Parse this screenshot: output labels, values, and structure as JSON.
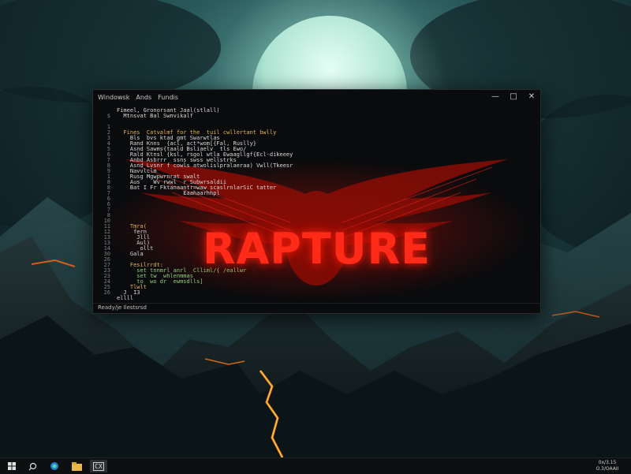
{
  "terminal": {
    "menu": [
      "Windowsk",
      "Ands",
      "Fundis"
    ],
    "status": "Ready/je Ilestsrsd",
    "logo_text": "RAPTURE",
    "lines": [
      {
        "num": "",
        "text": "Fimeel, Gronorsant Jaal(stlall)",
        "color": "#d8d8d8"
      },
      {
        "num": "$",
        "text": "  Mtnsvat Bal Swnvikalf",
        "color": "#d8d8d8"
      },
      {
        "num": "",
        "text": "",
        "color": "#d8d8d8"
      },
      {
        "num": "1",
        "text": "",
        "color": "#d8d8d8"
      },
      {
        "num": "2",
        "text": "  Fines  Catvalmf for the  tuil cwllertant bwlly",
        "color": "#e8b44c"
      },
      {
        "num": "3",
        "text": "    Bls  bvs ktad gmt Swarwtlas",
        "color": "#d8d8d8"
      },
      {
        "num": "4",
        "text": "    Rand Knns  {acl, act*wom[{Fal, Ruslly}",
        "color": "#d8d8d8"
      },
      {
        "num": "5",
        "text": "    Asnd Sawms{taald Bsliaelv  tls Ewo/",
        "color": "#d8d8d8"
      },
      {
        "num": "6",
        "text": "    Rald Ktnsl {ksl, rsgol wtla Ewaagllgf{Ecl-dikeeey",
        "color": "#d8d8d8"
      },
      {
        "num": "7",
        "text": "    Anbd Asbrrr  ssns swss wellstrks",
        "color": "#d8d8d8"
      },
      {
        "num": "8",
        "text": "    Asnd Lvsnr f cowls atwolislpralaeraa) Vwll(Tkeesr",
        "color": "#d8d8d8"
      },
      {
        "num": "9",
        "text": "    Navvlclm",
        "color": "#d8d8d8"
      },
      {
        "num": "1",
        "text": "    Rusg Mgwpwrnrat swalt",
        "color": "#d8d8d8"
      },
      {
        "num": "8",
        "text": "    Aus    Wv rwwl  r Subwrsaldii",
        "color": "#d8d8d8"
      },
      {
        "num": "8",
        "text": "    Bat I Fr Fktanaantr=waw scaslrnlarSiC tatter",
        "color": "#d8d8d8"
      },
      {
        "num": "7",
        "text": "                    Eaahaarhhpl",
        "color": "#d8d8d8"
      },
      {
        "num": "6",
        "text": "",
        "color": "#d8d8d8"
      },
      {
        "num": "6",
        "text": "",
        "color": "#d8d8d8"
      },
      {
        "num": "7",
        "text": "",
        "color": "#d8d8d8"
      },
      {
        "num": "8",
        "text": "",
        "color": "#d8d8d8"
      },
      {
        "num": "10",
        "text": "",
        "color": "#d8d8d8"
      },
      {
        "num": "11",
        "text": "    Tmra(",
        "color": "#e8b44c"
      },
      {
        "num": "12",
        "text": "     fern",
        "color": "#d8d8d8"
      },
      {
        "num": "13",
        "text": "      Jlll",
        "color": "#d8d8d8"
      },
      {
        "num": "13",
        "text": "      Aul)",
        "color": "#d8d8d8"
      },
      {
        "num": "14",
        "text": "       ollt",
        "color": "#d8d8d8"
      },
      {
        "num": "30",
        "text": "    Gala",
        "color": "#d8d8d8"
      },
      {
        "num": "26",
        "text": "",
        "color": "#d8d8d8"
      },
      {
        "num": "27",
        "text": "    Fesilrrdt:",
        "color": "#e8b44c"
      },
      {
        "num": "23",
        "text": "      set tnnmrl anrl  Clliml/{ /eallwr",
        "color": "#8fd07a"
      },
      {
        "num": "23",
        "text": "      set tw  whlenmmas",
        "color": "#8fd07a"
      },
      {
        "num": "24",
        "text": "      to  wo dr  ewmsdlls]",
        "color": "#8fd07a"
      },
      {
        "num": "25",
        "text": "    Tlwlt",
        "color": "#e8b44c"
      },
      {
        "num": "26",
        "text": "  J  I3",
        "color": "#d8d8d8"
      },
      {
        "num": "",
        "text": "ellll",
        "color": "#d8d8d8"
      }
    ]
  },
  "taskbar": {
    "start_icon": "windows-icon",
    "search_icon": "search-icon",
    "icons": [
      "edge-icon",
      "file-explorer-icon",
      "terminal-icon"
    ],
    "active_icon_label": "CX",
    "clock": [
      "0x/3.15",
      "O.3/OAAII"
    ]
  },
  "colors": {
    "accent_red": "#ff2a17",
    "code_keyword": "#e8b44c",
    "code_string": "#8fd07a",
    "terminal_bg": "#0a0b0d"
  }
}
